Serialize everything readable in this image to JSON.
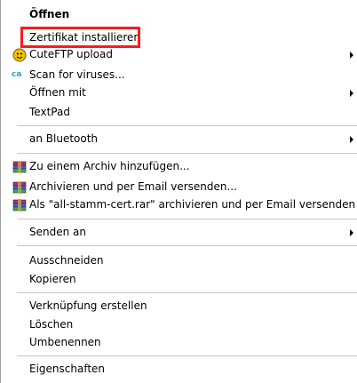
{
  "menu": {
    "items": [
      {
        "label": "Öffnen"
      },
      {
        "label": "Zertifikat installieren"
      },
      {
        "label": "CuteFTP upload",
        "icon": "cuteftp-icon"
      },
      {
        "label": "Scan for viruses...",
        "icon": "antivirus-ca-icon"
      },
      {
        "label": "Öffnen mit"
      },
      {
        "label": "TextPad"
      },
      {
        "label": "an Bluetooth"
      },
      {
        "label": "Zu einem Archiv hinzufügen...",
        "icon": "winrar-icon"
      },
      {
        "label": "Archivieren und per Email versenden...",
        "icon": "winrar-icon"
      },
      {
        "label": "Als \"all-stamm-cert.rar\" archivieren und per Email versenden",
        "icon": "winrar-icon"
      },
      {
        "label": "Senden an"
      },
      {
        "label": "Ausschneiden"
      },
      {
        "label": "Kopieren"
      },
      {
        "label": "Verknüpfung erstellen"
      },
      {
        "label": "Löschen"
      },
      {
        "label": "Umbenennen"
      },
      {
        "label": "Eigenschaften"
      }
    ],
    "icon_text": {
      "antivirus": "ca"
    }
  },
  "colors": {
    "highlight_border": "#ff1a1a",
    "separator": "#c7c7c7"
  }
}
